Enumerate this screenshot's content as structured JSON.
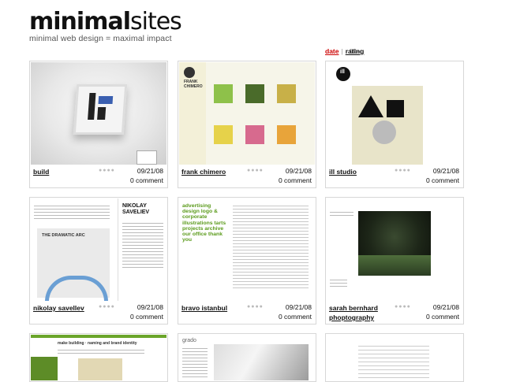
{
  "header": {
    "logo_bold": "minimal",
    "logo_light": "sites",
    "tagline": "minimal web design = maximal impact"
  },
  "filter": {
    "label": "filter",
    "options": [
      "date",
      "rating"
    ],
    "active": "date"
  },
  "colors": {
    "accent": "#cc0000",
    "frank_green": "#6aa52a",
    "bravo_green": "#5a9a1a"
  },
  "sites": [
    {
      "name": "build",
      "date": "09/21/08",
      "comments": "0 comment"
    },
    {
      "name": "frank chimero",
      "date": "09/21/08",
      "comments": "0 comment"
    },
    {
      "name": "ill studio",
      "date": "09/21/08",
      "comments": "0 comment"
    },
    {
      "name": "nikolay savellev",
      "date": "09/21/08",
      "comments": "0 comment"
    },
    {
      "name": "bravo istanbul",
      "date": "09/21/08",
      "comments": "0 comment"
    },
    {
      "name": "sarah bernhard phoptography",
      "date": "09/21/08",
      "comments": "0 comment"
    }
  ],
  "rating_dots": "●●●●",
  "thumbs": {
    "nik_title": "NIKOLAY SAVELIEV",
    "nik_book": "THE DRAMATIC ARC",
    "bravo_words": "advertising design logo & corporate illustrations tarts projects archive our office thank you",
    "frank_title": "FRANK CHIMERO",
    "ill_logo": "ill",
    "g1_title": "make building · naming and brand identity",
    "g2_logo": "grado"
  }
}
